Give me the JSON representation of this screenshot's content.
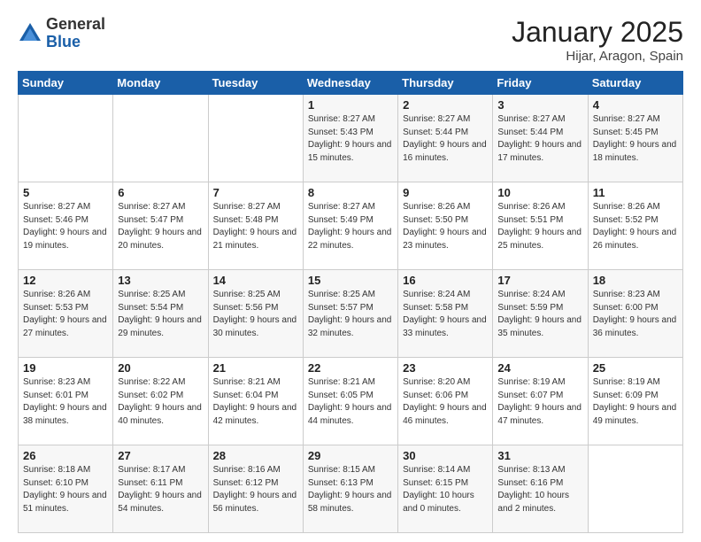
{
  "logo": {
    "general": "General",
    "blue": "Blue"
  },
  "header": {
    "title": "January 2025",
    "location": "Hijar, Aragon, Spain"
  },
  "weekdays": [
    "Sunday",
    "Monday",
    "Tuesday",
    "Wednesday",
    "Thursday",
    "Friday",
    "Saturday"
  ],
  "weeks": [
    [
      {
        "day": "",
        "sunrise": "",
        "sunset": "",
        "daylight": ""
      },
      {
        "day": "",
        "sunrise": "",
        "sunset": "",
        "daylight": ""
      },
      {
        "day": "",
        "sunrise": "",
        "sunset": "",
        "daylight": ""
      },
      {
        "day": "1",
        "sunrise": "Sunrise: 8:27 AM",
        "sunset": "Sunset: 5:43 PM",
        "daylight": "Daylight: 9 hours and 15 minutes."
      },
      {
        "day": "2",
        "sunrise": "Sunrise: 8:27 AM",
        "sunset": "Sunset: 5:44 PM",
        "daylight": "Daylight: 9 hours and 16 minutes."
      },
      {
        "day": "3",
        "sunrise": "Sunrise: 8:27 AM",
        "sunset": "Sunset: 5:44 PM",
        "daylight": "Daylight: 9 hours and 17 minutes."
      },
      {
        "day": "4",
        "sunrise": "Sunrise: 8:27 AM",
        "sunset": "Sunset: 5:45 PM",
        "daylight": "Daylight: 9 hours and 18 minutes."
      }
    ],
    [
      {
        "day": "5",
        "sunrise": "Sunrise: 8:27 AM",
        "sunset": "Sunset: 5:46 PM",
        "daylight": "Daylight: 9 hours and 19 minutes."
      },
      {
        "day": "6",
        "sunrise": "Sunrise: 8:27 AM",
        "sunset": "Sunset: 5:47 PM",
        "daylight": "Daylight: 9 hours and 20 minutes."
      },
      {
        "day": "7",
        "sunrise": "Sunrise: 8:27 AM",
        "sunset": "Sunset: 5:48 PM",
        "daylight": "Daylight: 9 hours and 21 minutes."
      },
      {
        "day": "8",
        "sunrise": "Sunrise: 8:27 AM",
        "sunset": "Sunset: 5:49 PM",
        "daylight": "Daylight: 9 hours and 22 minutes."
      },
      {
        "day": "9",
        "sunrise": "Sunrise: 8:26 AM",
        "sunset": "Sunset: 5:50 PM",
        "daylight": "Daylight: 9 hours and 23 minutes."
      },
      {
        "day": "10",
        "sunrise": "Sunrise: 8:26 AM",
        "sunset": "Sunset: 5:51 PM",
        "daylight": "Daylight: 9 hours and 25 minutes."
      },
      {
        "day": "11",
        "sunrise": "Sunrise: 8:26 AM",
        "sunset": "Sunset: 5:52 PM",
        "daylight": "Daylight: 9 hours and 26 minutes."
      }
    ],
    [
      {
        "day": "12",
        "sunrise": "Sunrise: 8:26 AM",
        "sunset": "Sunset: 5:53 PM",
        "daylight": "Daylight: 9 hours and 27 minutes."
      },
      {
        "day": "13",
        "sunrise": "Sunrise: 8:25 AM",
        "sunset": "Sunset: 5:54 PM",
        "daylight": "Daylight: 9 hours and 29 minutes."
      },
      {
        "day": "14",
        "sunrise": "Sunrise: 8:25 AM",
        "sunset": "Sunset: 5:56 PM",
        "daylight": "Daylight: 9 hours and 30 minutes."
      },
      {
        "day": "15",
        "sunrise": "Sunrise: 8:25 AM",
        "sunset": "Sunset: 5:57 PM",
        "daylight": "Daylight: 9 hours and 32 minutes."
      },
      {
        "day": "16",
        "sunrise": "Sunrise: 8:24 AM",
        "sunset": "Sunset: 5:58 PM",
        "daylight": "Daylight: 9 hours and 33 minutes."
      },
      {
        "day": "17",
        "sunrise": "Sunrise: 8:24 AM",
        "sunset": "Sunset: 5:59 PM",
        "daylight": "Daylight: 9 hours and 35 minutes."
      },
      {
        "day": "18",
        "sunrise": "Sunrise: 8:23 AM",
        "sunset": "Sunset: 6:00 PM",
        "daylight": "Daylight: 9 hours and 36 minutes."
      }
    ],
    [
      {
        "day": "19",
        "sunrise": "Sunrise: 8:23 AM",
        "sunset": "Sunset: 6:01 PM",
        "daylight": "Daylight: 9 hours and 38 minutes."
      },
      {
        "day": "20",
        "sunrise": "Sunrise: 8:22 AM",
        "sunset": "Sunset: 6:02 PM",
        "daylight": "Daylight: 9 hours and 40 minutes."
      },
      {
        "day": "21",
        "sunrise": "Sunrise: 8:21 AM",
        "sunset": "Sunset: 6:04 PM",
        "daylight": "Daylight: 9 hours and 42 minutes."
      },
      {
        "day": "22",
        "sunrise": "Sunrise: 8:21 AM",
        "sunset": "Sunset: 6:05 PM",
        "daylight": "Daylight: 9 hours and 44 minutes."
      },
      {
        "day": "23",
        "sunrise": "Sunrise: 8:20 AM",
        "sunset": "Sunset: 6:06 PM",
        "daylight": "Daylight: 9 hours and 46 minutes."
      },
      {
        "day": "24",
        "sunrise": "Sunrise: 8:19 AM",
        "sunset": "Sunset: 6:07 PM",
        "daylight": "Daylight: 9 hours and 47 minutes."
      },
      {
        "day": "25",
        "sunrise": "Sunrise: 8:19 AM",
        "sunset": "Sunset: 6:09 PM",
        "daylight": "Daylight: 9 hours and 49 minutes."
      }
    ],
    [
      {
        "day": "26",
        "sunrise": "Sunrise: 8:18 AM",
        "sunset": "Sunset: 6:10 PM",
        "daylight": "Daylight: 9 hours and 51 minutes."
      },
      {
        "day": "27",
        "sunrise": "Sunrise: 8:17 AM",
        "sunset": "Sunset: 6:11 PM",
        "daylight": "Daylight: 9 hours and 54 minutes."
      },
      {
        "day": "28",
        "sunrise": "Sunrise: 8:16 AM",
        "sunset": "Sunset: 6:12 PM",
        "daylight": "Daylight: 9 hours and 56 minutes."
      },
      {
        "day": "29",
        "sunrise": "Sunrise: 8:15 AM",
        "sunset": "Sunset: 6:13 PM",
        "daylight": "Daylight: 9 hours and 58 minutes."
      },
      {
        "day": "30",
        "sunrise": "Sunrise: 8:14 AM",
        "sunset": "Sunset: 6:15 PM",
        "daylight": "Daylight: 10 hours and 0 minutes."
      },
      {
        "day": "31",
        "sunrise": "Sunrise: 8:13 AM",
        "sunset": "Sunset: 6:16 PM",
        "daylight": "Daylight: 10 hours and 2 minutes."
      },
      {
        "day": "",
        "sunrise": "",
        "sunset": "",
        "daylight": ""
      }
    ]
  ]
}
